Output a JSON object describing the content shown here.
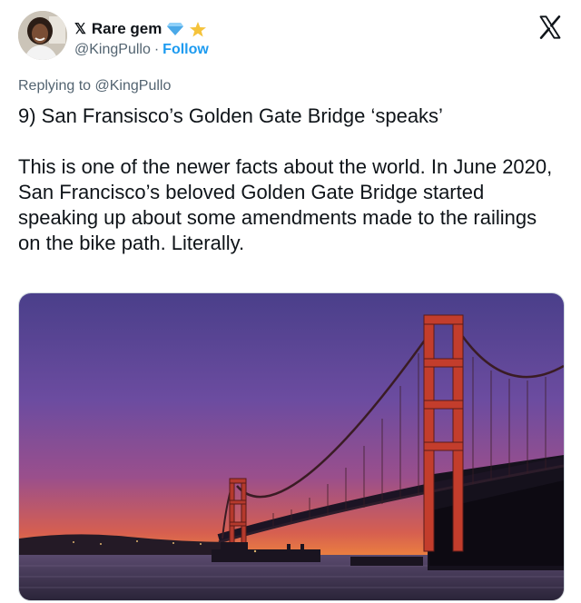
{
  "author": {
    "display_name": "Rare gem",
    "handle": "@KingPullo",
    "separator": "·",
    "follow_label": "Follow"
  },
  "reply": {
    "prefix": "Replying to",
    "mention": "@KingPullo"
  },
  "tweet": {
    "paragraph1": "9) San Fransisco’s Golden Gate Bridge ‘speaks’",
    "paragraph2": "This is one of the newer facts about the world. In June 2020, San Francisco’s beloved Golden Gate Bridge started speaking up about some amendments made to the railings on the bike path. Literally."
  },
  "icons": {
    "badge": "x-badge-icon",
    "verified": "diamond-icon",
    "emoji": "star-emoji-icon",
    "brand": "x-logo-icon"
  },
  "colors": {
    "link": "#1d9bf0",
    "muted": "#536471",
    "text": "#0f1419"
  }
}
